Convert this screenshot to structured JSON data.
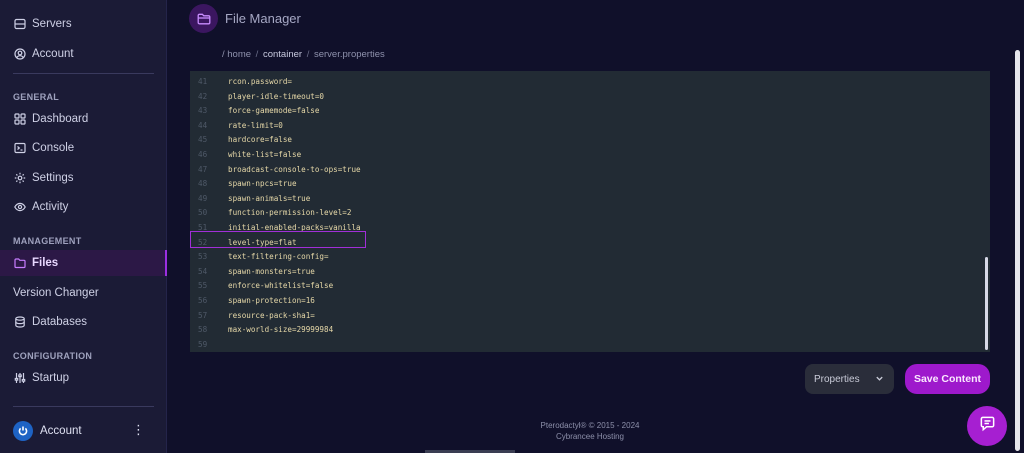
{
  "sidebar": {
    "top_items": [
      {
        "label": "Servers",
        "icon": "server-icon"
      },
      {
        "label": "Account",
        "icon": "user-circle-icon"
      }
    ],
    "sections": {
      "general": "GENERAL",
      "management": "MANAGEMENT",
      "configuration": "CONFIGURATION"
    },
    "general_items": [
      {
        "label": "Dashboard",
        "icon": "grid-icon"
      },
      {
        "label": "Console",
        "icon": "terminal-icon"
      },
      {
        "label": "Settings",
        "icon": "gear-icon"
      },
      {
        "label": "Activity",
        "icon": "eye-icon"
      }
    ],
    "management_items": [
      {
        "label": "Files",
        "icon": "folder-icon",
        "active": true
      },
      {
        "label": "Version Changer"
      },
      {
        "label": "Databases",
        "icon": "database-icon"
      }
    ],
    "configuration_items": [
      {
        "label": "Startup",
        "icon": "sliders-icon"
      }
    ],
    "footer_account": "Account"
  },
  "header": {
    "title": "File Manager"
  },
  "breadcrumb": {
    "root": "/ home",
    "container": "container",
    "file": "server.properties"
  },
  "editor": {
    "lines": [
      {
        "n": "41",
        "code": "rcon.password="
      },
      {
        "n": "42",
        "code": "player-idle-timeout=0"
      },
      {
        "n": "43",
        "code": "force-gamemode=false"
      },
      {
        "n": "44",
        "code": "rate-limit=0"
      },
      {
        "n": "45",
        "code": "hardcore=false"
      },
      {
        "n": "46",
        "code": "white-list=false"
      },
      {
        "n": "47",
        "code": "broadcast-console-to-ops=true"
      },
      {
        "n": "48",
        "code": "spawn-npcs=true"
      },
      {
        "n": "49",
        "code": "spawn-animals=true"
      },
      {
        "n": "50",
        "code": "function-permission-level=2"
      },
      {
        "n": "51",
        "code": "initial-enabled-packs=vanilla"
      },
      {
        "n": "52",
        "code": "level-type=flat"
      },
      {
        "n": "53",
        "code": "text-filtering-config="
      },
      {
        "n": "54",
        "code": "spawn-monsters=true"
      },
      {
        "n": "55",
        "code": "enforce-whitelist=false"
      },
      {
        "n": "56",
        "code": "spawn-protection=16"
      },
      {
        "n": "57",
        "code": "resource-pack-sha1="
      },
      {
        "n": "58",
        "code": "max-world-size=29999984"
      },
      {
        "n": "59",
        "code": ""
      }
    ],
    "highlight_color": "#a12fd8"
  },
  "controls": {
    "mode_select": "Properties",
    "save_label": "Save Content"
  },
  "footer": {
    "copyright": "Pterodactyl® © 2015 - 2024",
    "host": "Cybrancee Hosting"
  },
  "colors": {
    "accent": "#9e19cc",
    "background": "#10102a",
    "sidebar": "#1b1b36",
    "editor": "#222b34"
  }
}
